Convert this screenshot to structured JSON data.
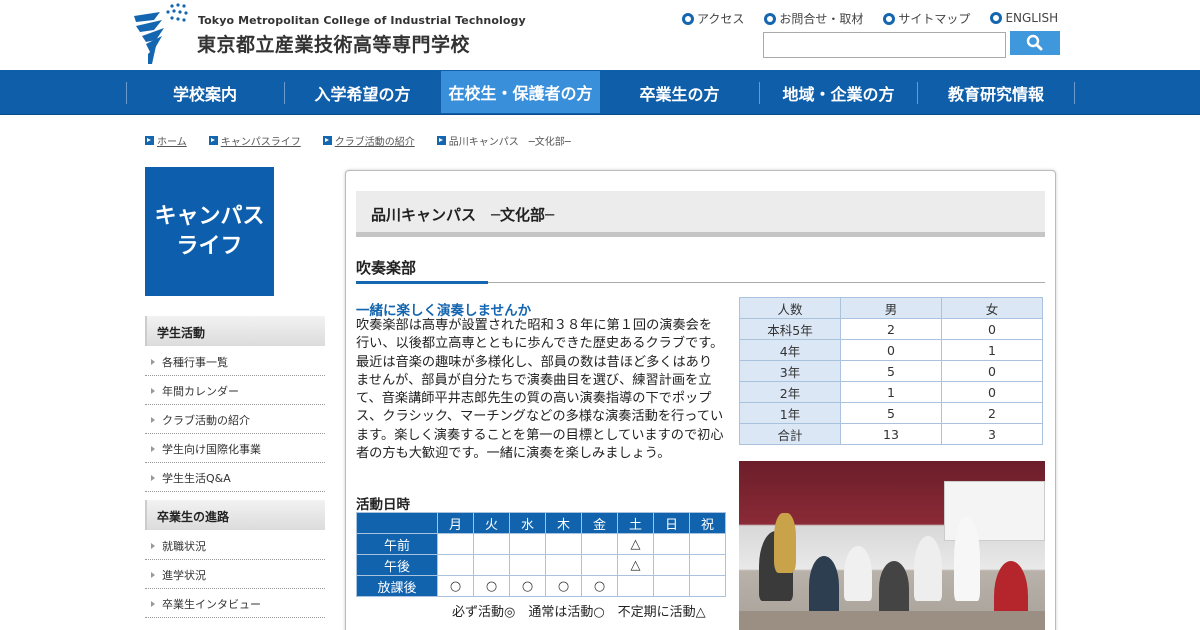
{
  "header": {
    "logo_en": "Tokyo Metropolitan College of Industrial Technology",
    "logo_ja": "東京都立産業技術高等専門学校",
    "links": [
      "アクセス",
      "お問合せ・取材",
      "サイトマップ",
      "ENGLISH"
    ],
    "search_value": ""
  },
  "nav": [
    "学校案内",
    "入学希望の方",
    "在校生・保護者の方",
    "卒業生の方",
    "地域・企業の方",
    "教育研究情報"
  ],
  "breadcrumb": [
    "ホーム",
    "キャンパスライフ",
    "クラブ活動の紹介",
    "品川キャンパス　─文化部─"
  ],
  "sidebar": {
    "banner_line1": "キャンパス",
    "banner_line2": "ライフ",
    "group1": "学生活動",
    "group1_items": [
      "各種行事一覧",
      "年間カレンダー",
      "クラブ活動の紹介",
      "学生向け国際化事業",
      "学生生活Q&A"
    ],
    "group2": "卒業生の進路",
    "group2_items": [
      "就職状況",
      "進学状況",
      "卒業生インタビュー"
    ]
  },
  "main": {
    "page_title": "品川キャンパス　─文化部─",
    "section_title": "吹奏楽部",
    "lead": "一緒に楽しく演奏しませんか",
    "body": "吹奏楽部は高専が設置された昭和３８年に第１回の演奏会を行い、以後都立高専とともに歩んできた歴史あるクラブです。最近は音楽の趣味が多様化し、部員の数は昔ほど多くはありませんが、部員が自分たちで演奏曲目を選び、練習計画を立て、音楽講師平井志郎先生の質の高い演奏指導の下でポップス、クラシック、マーチングなどの多様な演奏活動を行っています。楽しく演奏することを第一の目標としていますので初心者の方も大歓迎です。一緒に演奏を楽しみましょう。",
    "schedule_title": "活動日時",
    "schedule_days": [
      "月",
      "火",
      "水",
      "木",
      "金",
      "土",
      "日",
      "祝"
    ],
    "schedule_rows": [
      {
        "label": "午前",
        "cells": [
          "",
          "",
          "",
          "",
          "",
          "△",
          "",
          ""
        ]
      },
      {
        "label": "午後",
        "cells": [
          "",
          "",
          "",
          "",
          "",
          "△",
          "",
          ""
        ]
      },
      {
        "label": "放課後",
        "cells": [
          "○",
          "○",
          "○",
          "○",
          "○",
          "",
          "",
          ""
        ]
      }
    ],
    "legend": "必ず活動◎　通常は活動○　不定期に活動△",
    "stats_header": [
      "人数",
      "男",
      "女"
    ],
    "stats_rows": [
      [
        "本科5年",
        "2",
        "0"
      ],
      [
        "4年",
        "0",
        "1"
      ],
      [
        "3年",
        "5",
        "0"
      ],
      [
        "2年",
        "1",
        "0"
      ],
      [
        "1年",
        "5",
        "2"
      ],
      [
        "合計",
        "13",
        "3"
      ]
    ]
  }
}
